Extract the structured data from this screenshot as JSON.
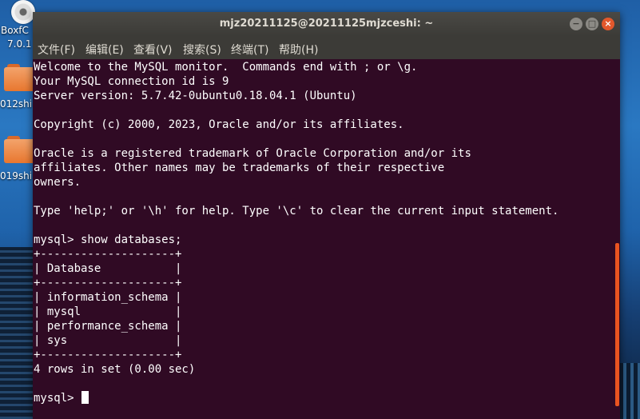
{
  "desktop": {
    "icons": [
      {
        "label": "BoxfC",
        "sublabel": "7.0.1",
        "icon": "disc-icon"
      },
      {
        "label": "012shi",
        "icon": "folder-icon"
      },
      {
        "label": "019shi",
        "icon": "folder-icon"
      }
    ]
  },
  "window": {
    "title": "mjz20211125@20211125mjzceshi: ~",
    "buttons": {
      "minimize": "−",
      "maximize": "□",
      "close": "×"
    },
    "menu": [
      "文件(F)",
      "编辑(E)",
      "查看(V)",
      "搜索(S)",
      "终端(T)",
      "帮助(H)"
    ],
    "colors": {
      "background": "#300a24",
      "text": "#ffffff",
      "scrollbar": "#e95420"
    }
  },
  "terminal": {
    "lines": [
      "Welcome to the MySQL monitor.  Commands end with ; or \\g.",
      "Your MySQL connection id is 9",
      "Server version: 5.7.42-0ubuntu0.18.04.1 (Ubuntu)",
      "",
      "Copyright (c) 2000, 2023, Oracle and/or its affiliates.",
      "",
      "Oracle is a registered trademark of Oracle Corporation and/or its",
      "affiliates. Other names may be trademarks of their respective",
      "owners.",
      "",
      "Type 'help;' or '\\h' for help. Type '\\c' to clear the current input statement.",
      "",
      "mysql> show databases;",
      "+--------------------+",
      "| Database           |",
      "+--------------------+",
      "| information_schema |",
      "| mysql              |",
      "| performance_schema |",
      "| sys                |",
      "+--------------------+",
      "4 rows in set (0.00 sec)",
      ""
    ],
    "prompt": "mysql> "
  }
}
